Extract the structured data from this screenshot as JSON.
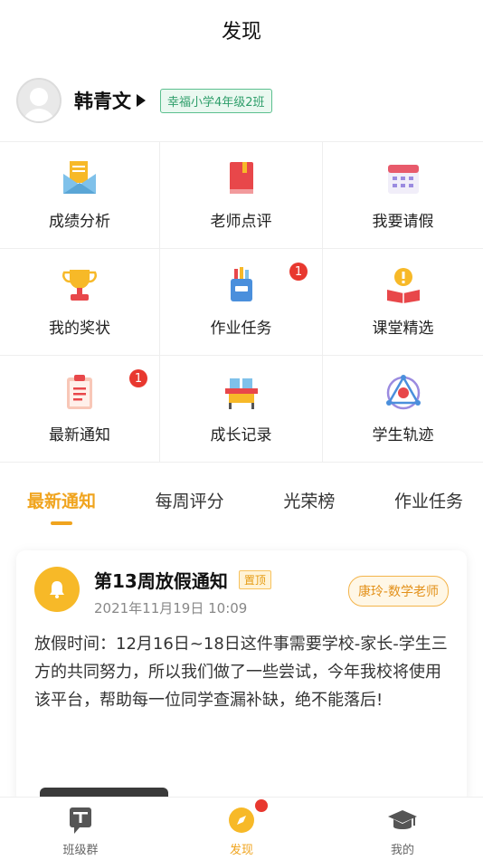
{
  "header": {
    "title": "发现"
  },
  "profile": {
    "name": "韩青文",
    "class_badge": "幸福小学4年级2班"
  },
  "grid": {
    "items": [
      {
        "label": "成绩分析",
        "icon": "envelope-report-icon"
      },
      {
        "label": "老师点评",
        "icon": "red-book-icon"
      },
      {
        "label": "我要请假",
        "icon": "calendar-icon"
      },
      {
        "label": "我的奖状",
        "icon": "trophy-icon"
      },
      {
        "label": "作业任务",
        "icon": "pencil-cup-icon",
        "badge": "1"
      },
      {
        "label": "课堂精选",
        "icon": "open-book-icon"
      },
      {
        "label": "最新通知",
        "icon": "clipboard-icon",
        "badge": "1"
      },
      {
        "label": "成长记录",
        "icon": "desk-icon"
      },
      {
        "label": "学生轨迹",
        "icon": "trajectory-icon"
      }
    ]
  },
  "tabs": [
    {
      "label": "最新通知",
      "active": true
    },
    {
      "label": "每周评分"
    },
    {
      "label": "光荣榜"
    },
    {
      "label": "作业任务"
    }
  ],
  "notice": {
    "title": "第13周放假通知",
    "pin_label": "置顶",
    "date": "2021年11月19日 10:09",
    "teacher": "康玲-数学老师",
    "body": "放假时间：12月16日~18日这件事需要学校-家长-学生三方的共同努力，所以我们做了一些尝试，今年我校将使用该平台，帮助每一位同学查漏补缺，绝不能落后!"
  },
  "bottom_nav": [
    {
      "label": "班级群",
      "icon": "class-group-icon"
    },
    {
      "label": "发现",
      "icon": "compass-icon",
      "active": true
    },
    {
      "label": "我的",
      "icon": "graduation-cap-icon"
    }
  ],
  "colors": {
    "accent": "#f0a41e",
    "badge_red": "#e8382f",
    "class_green": "#2e9e6a"
  }
}
